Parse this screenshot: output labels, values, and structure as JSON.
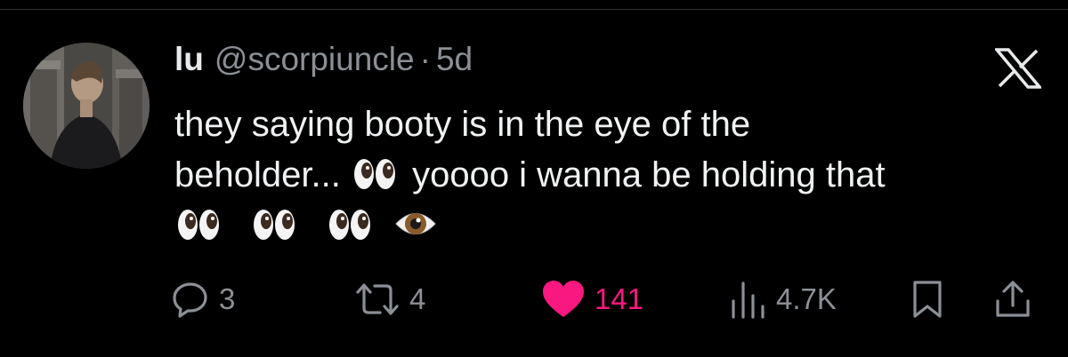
{
  "tweet": {
    "author": {
      "display_name": "lu",
      "handle": "@scorpiuncle",
      "separator": "·",
      "time": "5d"
    },
    "text_lines": [
      "they saying booty is in the eye of the",
      "beholder...",
      "yoooo i wanna be holding that"
    ],
    "emojis": [
      "eyes-emoji",
      "eyes-emoji",
      "eyes-emoji",
      "eyes-emoji",
      "eye-emoji"
    ],
    "logo_icon": "x-logo-icon",
    "actions": {
      "replies": "3",
      "reposts": "4",
      "likes": "141",
      "views": "4.7K"
    },
    "colors": {
      "background": "#000000",
      "text": "#e7e9ea",
      "secondary": "#8b9096",
      "like": "#f91880"
    }
  }
}
